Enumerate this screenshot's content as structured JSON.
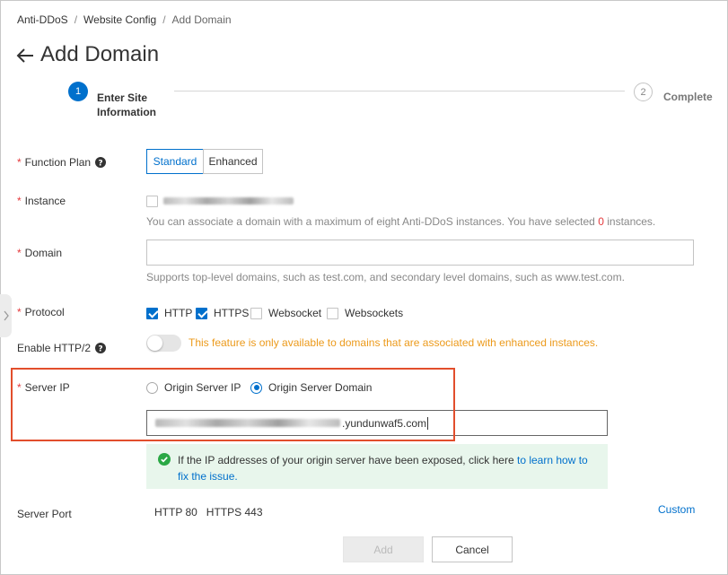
{
  "breadcrumb": {
    "items": [
      "Anti-DDoS",
      "Website Config",
      "Add Domain"
    ],
    "separator": "/"
  },
  "page": {
    "title": "Add Domain"
  },
  "steps": [
    {
      "number": "1",
      "label": "Enter Site Information",
      "state": "active"
    },
    {
      "number": "2",
      "label": "Complete",
      "state": "pending"
    }
  ],
  "form": {
    "function_plan": {
      "label": "Function Plan",
      "options": [
        "Standard",
        "Enhanced"
      ],
      "selected": "Standard"
    },
    "instance": {
      "label": "Instance",
      "hint_prefix": "You can associate a domain with a maximum of eight Anti-DDoS instances. You have selected",
      "selected_count": "0",
      "hint_suffix": "instances."
    },
    "domain": {
      "label": "Domain",
      "value": "",
      "hint": "Supports top-level domains, such as test.com, and secondary level domains, such as www.test.com."
    },
    "protocol": {
      "label": "Protocol",
      "options": [
        {
          "label": "HTTP",
          "checked": true
        },
        {
          "label": "HTTPS",
          "checked": true
        },
        {
          "label": "Websocket",
          "checked": false
        },
        {
          "label": "Websockets",
          "checked": false
        }
      ]
    },
    "http2": {
      "label": "Enable HTTP/2",
      "enabled": false,
      "warning": "This feature is only available to domains that are associated with enhanced instances."
    },
    "server_ip": {
      "label": "Server IP",
      "options": [
        "Origin Server IP",
        "Origin Server Domain"
      ],
      "selected": "Origin Server Domain",
      "value_suffix": ".yundunwaf5.com",
      "notice_text": "If the IP addresses of your origin server have been exposed, click here",
      "notice_link": "to learn how to fix the issue."
    },
    "server_port": {
      "label": "Server Port",
      "value": "HTTP 80   HTTPS 443",
      "custom_label": "Custom"
    }
  },
  "actions": {
    "add_label": "Add",
    "cancel_label": "Cancel"
  },
  "colors": {
    "primary": "#0070cc",
    "required": "#e4393c",
    "warning": "#ec9a1b",
    "success": "#2aa845",
    "highlight": "#e24e2c"
  }
}
